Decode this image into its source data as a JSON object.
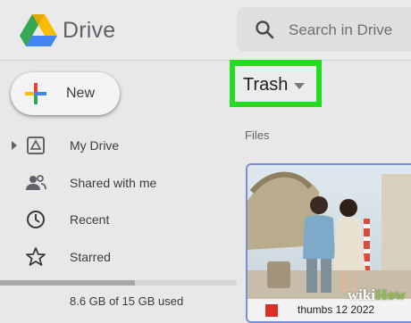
{
  "header": {
    "app_title": "Drive",
    "logo_icon": "google-drive-logo",
    "search": {
      "placeholder": "Search in Drive",
      "icon": "search-icon"
    }
  },
  "sidebar": {
    "new_button": {
      "label": "New",
      "icon": "plus-icon"
    },
    "items": [
      {
        "label": "My Drive",
        "icon": "my-drive-icon",
        "expandable": true
      },
      {
        "label": "Shared with me",
        "icon": "people-icon"
      },
      {
        "label": "Recent",
        "icon": "clock-icon"
      },
      {
        "label": "Starred",
        "icon": "star-icon"
      }
    ],
    "storage": {
      "text": "8.6 GB of 15 GB used",
      "used_fraction": 0.57
    }
  },
  "main": {
    "location": {
      "label": "Trash",
      "icon": "caret-down-icon",
      "highlighted": true
    },
    "section_heading": "Files",
    "files": [
      {
        "name": "thumbs 12 2022",
        "type_icon": "image-file-icon"
      }
    ]
  },
  "watermark": {
    "part_a": "wiki",
    "part_b": "How"
  },
  "colors": {
    "highlight": "#22dd22",
    "card_border": "#7a8fd1",
    "plus_red": "#ea4335",
    "plus_blue": "#4285f4",
    "plus_green": "#34a853",
    "plus_yellow": "#fbbc04"
  }
}
